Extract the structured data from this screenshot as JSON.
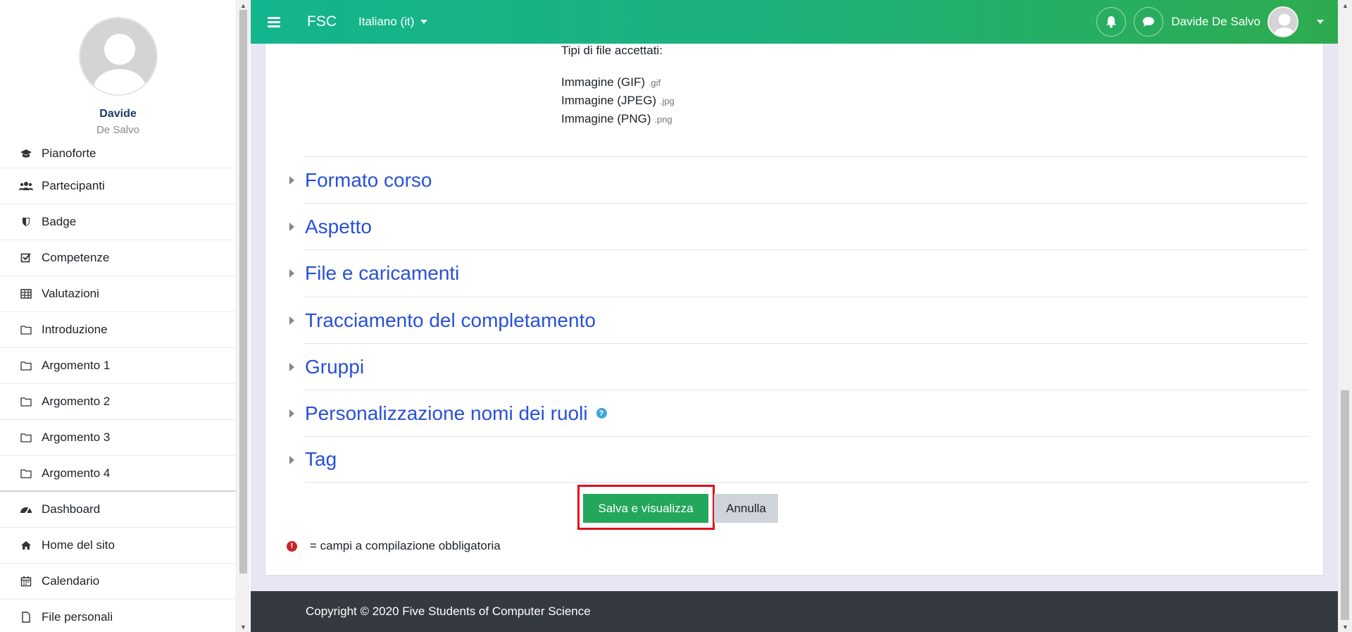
{
  "sidebar": {
    "user_first": "Davide",
    "user_last": "De Salvo",
    "items": [
      {
        "label": "Pianoforte",
        "icon": "graduation-cap-icon"
      },
      {
        "label": "Partecipanti",
        "icon": "users-icon"
      },
      {
        "label": "Badge",
        "icon": "shield-icon"
      },
      {
        "label": "Competenze",
        "icon": "check-square-icon"
      },
      {
        "label": "Valutazioni",
        "icon": "table-icon"
      },
      {
        "label": "Introduzione",
        "icon": "folder-icon"
      },
      {
        "label": "Argomento 1",
        "icon": "folder-icon"
      },
      {
        "label": "Argomento 2",
        "icon": "folder-icon"
      },
      {
        "label": "Argomento 3",
        "icon": "folder-icon"
      },
      {
        "label": "Argomento 4",
        "icon": "folder-icon"
      }
    ],
    "items2": [
      {
        "label": "Dashboard",
        "icon": "dashboard-icon"
      },
      {
        "label": "Home del sito",
        "icon": "home-icon"
      },
      {
        "label": "Calendario",
        "icon": "calendar-icon"
      },
      {
        "label": "File personali",
        "icon": "file-icon"
      }
    ]
  },
  "navbar": {
    "brand": "FSC",
    "language": "Italiano (it)",
    "user_name": "Davide De Salvo",
    "accent": "#16b48a"
  },
  "main": {
    "files_label": "Tipi di file accettati:",
    "file_types": [
      {
        "name": "Immagine (GIF)",
        "ext": ".gif"
      },
      {
        "name": "Immagine (JPEG)",
        "ext": ".jpg"
      },
      {
        "name": "Immagine (PNG)",
        "ext": ".png"
      }
    ],
    "sections": [
      "Formato corso",
      "Aspetto",
      "File e caricamenti",
      "Tracciamento del completamento",
      "Gruppi",
      "Personalizzazione nomi dei ruoli",
      "Tag"
    ],
    "save_label": "Salva e visualizza",
    "cancel_label": "Annulla",
    "required_note": "= campi a compilazione obbligatoria"
  },
  "footer": {
    "copyright": "Copyright © 2020 Five Students of Computer Science"
  }
}
